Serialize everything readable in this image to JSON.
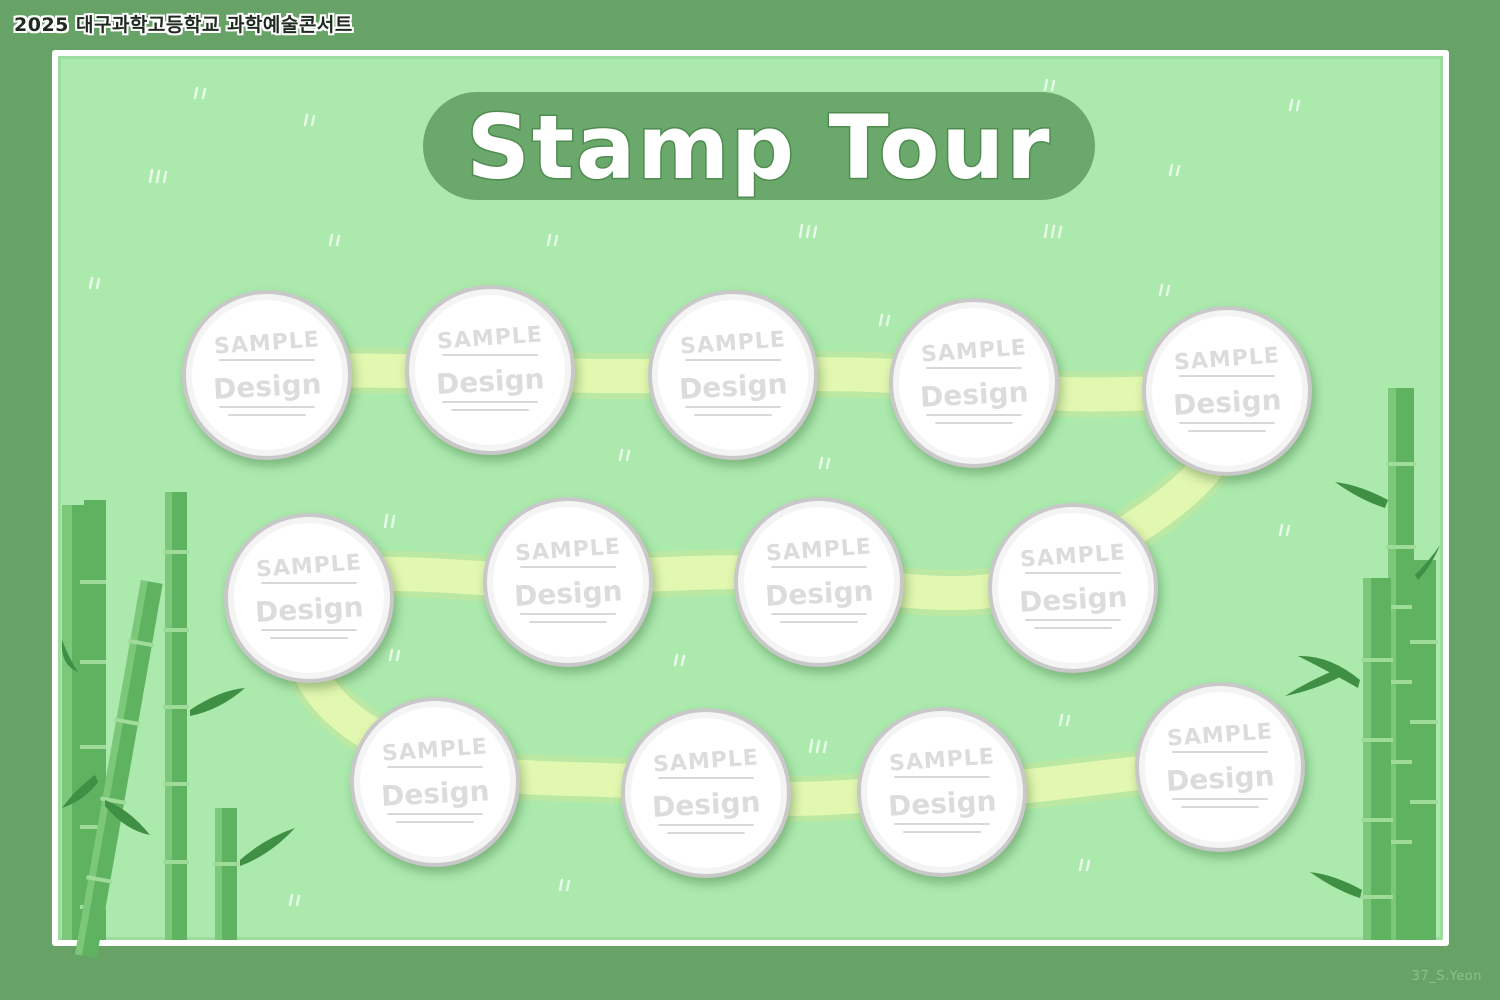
{
  "header": {
    "event_title": "2025 대구과학고등학교 과학예술콘서트"
  },
  "board": {
    "title": "Stamp Tour"
  },
  "stamps": [
    {
      "line1": "SAMPLE",
      "line2": "Design"
    },
    {
      "line1": "SAMPLE",
      "line2": "Design"
    },
    {
      "line1": "SAMPLE",
      "line2": "Design"
    },
    {
      "line1": "SAMPLE",
      "line2": "Design"
    },
    {
      "line1": "SAMPLE",
      "line2": "Design"
    },
    {
      "line1": "SAMPLE",
      "line2": "Design"
    },
    {
      "line1": "SAMPLE",
      "line2": "Design"
    },
    {
      "line1": "SAMPLE",
      "line2": "Design"
    },
    {
      "line1": "SAMPLE",
      "line2": "Design"
    },
    {
      "line1": "SAMPLE",
      "line2": "Design"
    },
    {
      "line1": "SAMPLE",
      "line2": "Design"
    },
    {
      "line1": "SAMPLE",
      "line2": "Design"
    },
    {
      "line1": "SAMPLE",
      "line2": "Design"
    }
  ],
  "footer": {
    "credit": "37_S.Yeon"
  },
  "colors": {
    "frame": "#67a367",
    "board_bg": "#abe9ad",
    "path": "#e2f7b0",
    "title_bg": "#6aa86b",
    "bamboo": "#5fb25f",
    "bamboo_dark": "#3f8f44"
  },
  "icons": [
    "bamboo-stalk-icon",
    "bamboo-leaf-icon",
    "grass-tuft-icon",
    "stamp-slot-icon"
  ]
}
